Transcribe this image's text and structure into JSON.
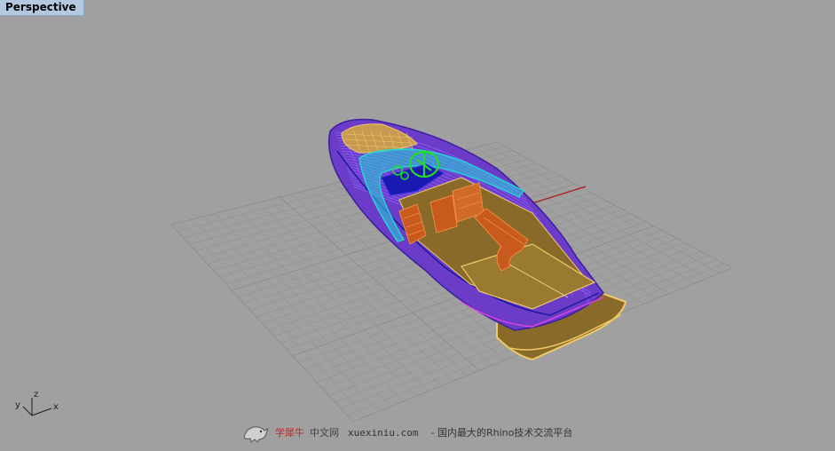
{
  "viewport": {
    "title": "Perspective"
  },
  "axis": {
    "x_label": "x",
    "y_label": "y",
    "z_label": "z"
  },
  "watermark": {
    "brand_red": "学犀牛",
    "brand_rest": "中文网",
    "url": "xuexiniu.com",
    "description": "- 国内最大的Rhino技术交流平台"
  },
  "colors": {
    "background": "#a0a0a0",
    "grid": "#8e8e8e",
    "hull": "#6a3cc8",
    "hull_lines": "#8f64ff",
    "deck": "#8a6a28",
    "deck_edge": "#f0c868",
    "seats": "#c85a1e",
    "steering": "#22dd22",
    "windshield": "#22d6d6",
    "x_axis": "#b01818"
  }
}
